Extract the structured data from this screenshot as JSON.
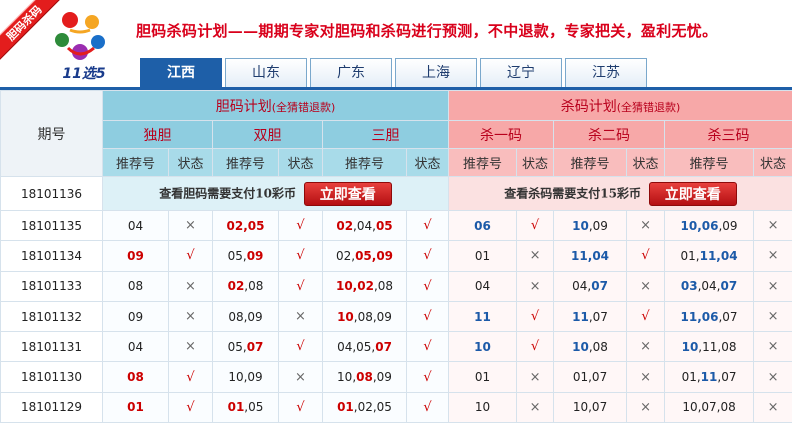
{
  "ribbon": "胆码杀码",
  "logo_text": "11选5",
  "headline": "胆码杀码计划——期期专家对胆码和杀码进行预测，不中退款，专家把关，盈利无忧。",
  "tabs": [
    "江西",
    "山东",
    "广东",
    "上海",
    "辽宁",
    "江苏"
  ],
  "table": {
    "qihao_label": "期号",
    "dan_title": "胆码计划",
    "dan_note": "(全猜错退款)",
    "sha_title": "杀码计划",
    "sha_note": "(全猜错退款)",
    "groups": [
      "独胆",
      "双胆",
      "三胆",
      "杀一码",
      "杀二码",
      "杀三码"
    ],
    "sub_rec": "推荐号",
    "sub_state": "状态",
    "pay_row": {
      "qihao": "18101136",
      "dan_text": "查看胆码需要支付10彩币",
      "sha_text": "查看杀码需要支付15彩币",
      "btn": "立即查看"
    },
    "rows": [
      {
        "qihao": "18101135",
        "c": [
          {
            "parts": [
              {
                "t": "04",
                "h": false
              }
            ],
            "s": "×"
          },
          {
            "parts": [
              {
                "t": "02",
                "h": true
              },
              {
                "t": ",",
                "h": true
              },
              {
                "t": "05",
                "h": true
              }
            ],
            "s": "√"
          },
          {
            "parts": [
              {
                "t": "02",
                "h": true
              },
              {
                "t": ",04,",
                "h": false
              },
              {
                "t": "05",
                "h": true
              }
            ],
            "s": "√"
          },
          {
            "parts": [
              {
                "t": "06",
                "h": true
              }
            ],
            "s": "√"
          },
          {
            "parts": [
              {
                "t": "10",
                "h": true
              },
              {
                "t": ",09",
                "h": false
              }
            ],
            "s": "×"
          },
          {
            "parts": [
              {
                "t": "10",
                "h": true
              },
              {
                "t": ",",
                "h": true
              },
              {
                "t": "06",
                "h": true
              },
              {
                "t": ",09",
                "h": false
              }
            ],
            "s": "×"
          }
        ]
      },
      {
        "qihao": "18101134",
        "c": [
          {
            "parts": [
              {
                "t": "09",
                "h": true
              }
            ],
            "s": "√"
          },
          {
            "parts": [
              {
                "t": "05,",
                "h": false
              },
              {
                "t": "09",
                "h": true
              }
            ],
            "s": "√"
          },
          {
            "parts": [
              {
                "t": "02,",
                "h": false
              },
              {
                "t": "05",
                "h": true
              },
              {
                "t": ",",
                "h": true
              },
              {
                "t": "09",
                "h": true
              }
            ],
            "s": "√"
          },
          {
            "parts": [
              {
                "t": "01",
                "h": false
              }
            ],
            "s": "×"
          },
          {
            "parts": [
              {
                "t": "11",
                "h": true
              },
              {
                "t": ",",
                "h": true
              },
              {
                "t": "04",
                "h": true
              }
            ],
            "s": "√"
          },
          {
            "parts": [
              {
                "t": "01,",
                "h": false
              },
              {
                "t": "11",
                "h": true
              },
              {
                "t": ",",
                "h": true
              },
              {
                "t": "04",
                "h": true
              }
            ],
            "s": "×"
          }
        ]
      },
      {
        "qihao": "18101133",
        "c": [
          {
            "parts": [
              {
                "t": "08",
                "h": false
              }
            ],
            "s": "×"
          },
          {
            "parts": [
              {
                "t": "02",
                "h": true
              },
              {
                "t": ",08",
                "h": false
              }
            ],
            "s": "√"
          },
          {
            "parts": [
              {
                "t": "10",
                "h": true
              },
              {
                "t": ",",
                "h": true
              },
              {
                "t": "02",
                "h": true
              },
              {
                "t": ",08",
                "h": false
              }
            ],
            "s": "√"
          },
          {
            "parts": [
              {
                "t": "04",
                "h": false
              }
            ],
            "s": "×"
          },
          {
            "parts": [
              {
                "t": "04,",
                "h": false
              },
              {
                "t": "07",
                "h": true
              }
            ],
            "s": "×"
          },
          {
            "parts": [
              {
                "t": "03",
                "h": true
              },
              {
                "t": ",04,",
                "h": false
              },
              {
                "t": "07",
                "h": true
              }
            ],
            "s": "×"
          }
        ]
      },
      {
        "qihao": "18101132",
        "c": [
          {
            "parts": [
              {
                "t": "09",
                "h": false
              }
            ],
            "s": "×"
          },
          {
            "parts": [
              {
                "t": "08,09",
                "h": false
              }
            ],
            "s": "×"
          },
          {
            "parts": [
              {
                "t": "10",
                "h": true
              },
              {
                "t": ",08,09",
                "h": false
              }
            ],
            "s": "√"
          },
          {
            "parts": [
              {
                "t": "11",
                "h": true
              }
            ],
            "s": "√"
          },
          {
            "parts": [
              {
                "t": "11",
                "h": true
              },
              {
                "t": ",07",
                "h": false
              }
            ],
            "s": "√"
          },
          {
            "parts": [
              {
                "t": "11",
                "h": true
              },
              {
                "t": ",",
                "h": true
              },
              {
                "t": "06",
                "h": true
              },
              {
                "t": ",07",
                "h": false
              }
            ],
            "s": "×"
          }
        ]
      },
      {
        "qihao": "18101131",
        "c": [
          {
            "parts": [
              {
                "t": "04",
                "h": false
              }
            ],
            "s": "×"
          },
          {
            "parts": [
              {
                "t": "05,",
                "h": false
              },
              {
                "t": "07",
                "h": true
              }
            ],
            "s": "√"
          },
          {
            "parts": [
              {
                "t": "04,05,",
                "h": false
              },
              {
                "t": "07",
                "h": true
              }
            ],
            "s": "√"
          },
          {
            "parts": [
              {
                "t": "10",
                "h": true
              }
            ],
            "s": "√"
          },
          {
            "parts": [
              {
                "t": "10",
                "h": true
              },
              {
                "t": ",08",
                "h": false
              }
            ],
            "s": "×"
          },
          {
            "parts": [
              {
                "t": "10",
                "h": true
              },
              {
                "t": ",11,08",
                "h": false
              }
            ],
            "s": "×"
          }
        ]
      },
      {
        "qihao": "18101130",
        "c": [
          {
            "parts": [
              {
                "t": "08",
                "h": true
              }
            ],
            "s": "√"
          },
          {
            "parts": [
              {
                "t": "10,09",
                "h": false
              }
            ],
            "s": "×"
          },
          {
            "parts": [
              {
                "t": "10,",
                "h": false
              },
              {
                "t": "08",
                "h": true
              },
              {
                "t": ",09",
                "h": false
              }
            ],
            "s": "√"
          },
          {
            "parts": [
              {
                "t": "01",
                "h": false
              }
            ],
            "s": "×"
          },
          {
            "parts": [
              {
                "t": "01,07",
                "h": false
              }
            ],
            "s": "×"
          },
          {
            "parts": [
              {
                "t": "01,",
                "h": false
              },
              {
                "t": "11",
                "h": true
              },
              {
                "t": ",07",
                "h": false
              }
            ],
            "s": "×"
          }
        ]
      },
      {
        "qihao": "18101129",
        "c": [
          {
            "parts": [
              {
                "t": "01",
                "h": true
              }
            ],
            "s": "√"
          },
          {
            "parts": [
              {
                "t": "01",
                "h": true
              },
              {
                "t": ",05",
                "h": false
              }
            ],
            "s": "√"
          },
          {
            "parts": [
              {
                "t": "01",
                "h": true
              },
              {
                "t": ",02,05",
                "h": false
              }
            ],
            "s": "√"
          },
          {
            "parts": [
              {
                "t": "10",
                "h": false
              }
            ],
            "s": "×"
          },
          {
            "parts": [
              {
                "t": "10,07",
                "h": false
              }
            ],
            "s": "×"
          },
          {
            "parts": [
              {
                "t": "10,07,08",
                "h": false
              }
            ],
            "s": "×"
          }
        ]
      }
    ]
  },
  "colors": {
    "accent_blue": "#1e5fa8",
    "header_blue": "#8ecde0",
    "header_red": "#f7a8a8",
    "hit_red": "#cc0000",
    "hit_blue": "#1c5aa8"
  },
  "icons": {
    "ok": "check-mark",
    "no": "cross-mark"
  }
}
